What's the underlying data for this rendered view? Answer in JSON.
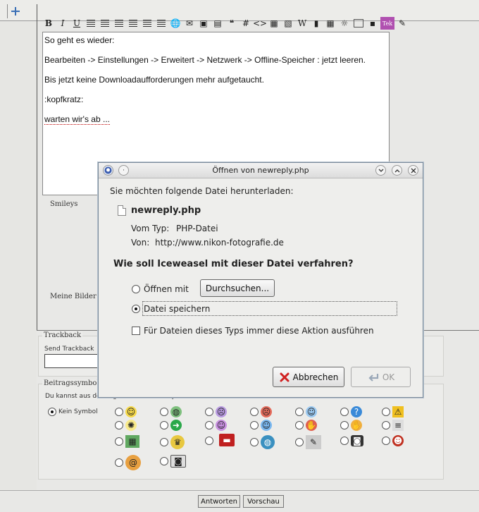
{
  "toolbar": {
    "bold": "B",
    "italic": "I",
    "underline": "U",
    "hash": "#",
    "code": "<>",
    "wiki": "W",
    "tex": "Tek"
  },
  "editor": {
    "lines": [
      "So geht es wieder:",
      "Bearbeiten -> Einstellungen -> Erweitert ->  Netzwerk -> Offline-Speicher : jetzt leeren.",
      "Bis jetzt keine Downloadaufforderungen mehr aufgetaucht.",
      ":kopfkratz:",
      "warten wir's ab ..."
    ]
  },
  "sections": {
    "smileys": "Smileys",
    "meine_bilder": "Meine Bilder",
    "trackback": "Trackback",
    "send_trackback": "Send Trackback",
    "beitragssymbole": "Beitragssymbole",
    "symbol_hint": "Du kannst aus der folgenden Liste ein Symbol für deine Nachricht auswählen:",
    "kein_symbol": "Kein Symbol"
  },
  "dialog": {
    "title": "Öffnen von newreply.php",
    "intro": "Sie möchten folgende Datei herunterladen:",
    "filename": "newreply.php",
    "type_label": "Vom Typ:",
    "type_value": "PHP-Datei",
    "from_label": "Von:",
    "from_value": "http://www.nikon-fotografie.de",
    "question": "Wie soll Iceweasel mit dieser Datei verfahren?",
    "open_with": "Öffnen mit",
    "browse": "Durchsuchen...",
    "save_file": "Datei speichern",
    "always": "Für Dateien dieses Typs immer diese Aktion ausführen",
    "cancel": "Abbrechen",
    "ok": "OK",
    "selected_option": "save_file"
  },
  "footer": {
    "reply": "Antworten",
    "preview": "Vorschau"
  }
}
